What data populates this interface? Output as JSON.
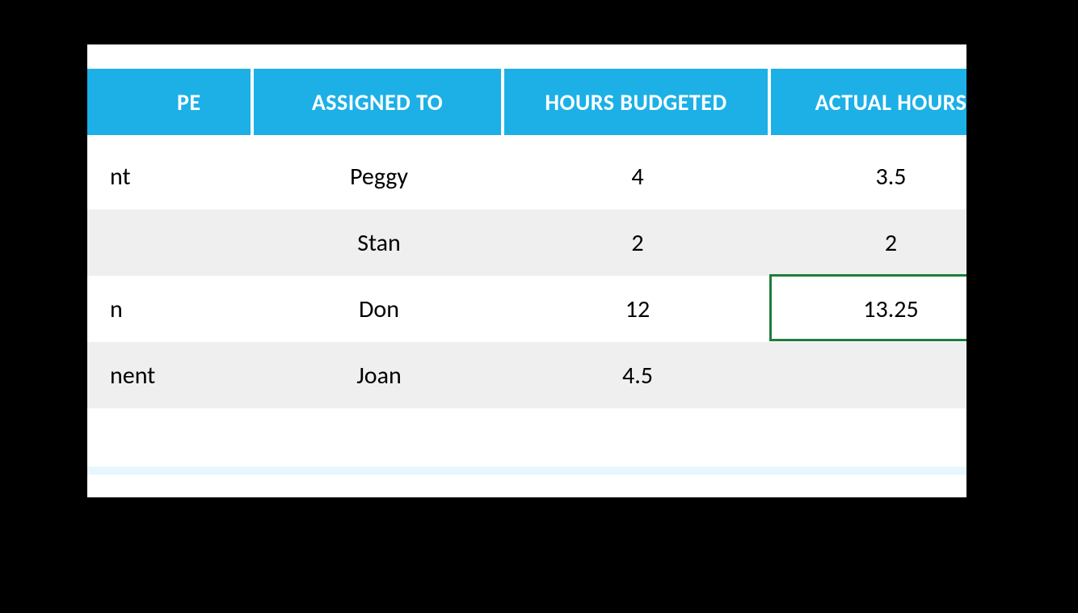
{
  "table": {
    "headers": {
      "type": "PE",
      "assigned": "ASSIGNED TO",
      "budget": "HOURS BUDGETED",
      "actual": "ACTUAL HOURS"
    },
    "rows": [
      {
        "type": "nt",
        "assigned": "Peggy",
        "budget": "4",
        "actual": "3.5"
      },
      {
        "type": "",
        "assigned": "Stan",
        "budget": "2",
        "actual": "2"
      },
      {
        "type": "n",
        "assigned": "Don",
        "budget": "12",
        "actual": "13.25"
      },
      {
        "type": "nent",
        "assigned": "Joan",
        "budget": "4.5",
        "actual": ""
      }
    ]
  },
  "colors": {
    "headerBg": "#1cb0e6",
    "altRowBg": "#efefef",
    "selectionBorder": "#1e7e3e"
  }
}
